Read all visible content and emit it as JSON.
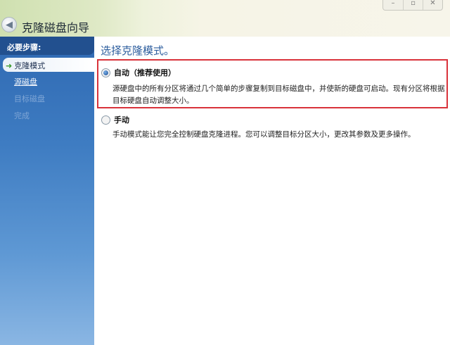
{
  "window": {
    "title": "克隆磁盘向导",
    "controls": {
      "minimize": "–",
      "maximize": "▫",
      "close": "✕"
    }
  },
  "sidebar": {
    "header": "必要步骤:",
    "items": [
      {
        "label": "克隆模式",
        "state": "current"
      },
      {
        "label": "源磁盘",
        "state": "link"
      },
      {
        "label": "目标磁盘",
        "state": "disabled"
      },
      {
        "label": "完成",
        "state": "disabled"
      }
    ]
  },
  "main": {
    "heading": "选择克隆模式。",
    "options": [
      {
        "label": "自动（推荐使用）",
        "selected": true,
        "description": "源硬盘中的所有分区将通过几个简单的步骤复制到目标磁盘中，并使新的硬盘可启动。现有分区将根据目标硬盘自动调整大小。"
      },
      {
        "label": "手动",
        "selected": false,
        "description": "手动模式能让您完全控制硬盘克隆进程。您可以调整目标分区大小，更改其参数及更多操作。"
      }
    ]
  },
  "colors": {
    "highlight": "#d9333b",
    "heading": "#2d5e9e",
    "sidebar": "#3e7cc2"
  }
}
